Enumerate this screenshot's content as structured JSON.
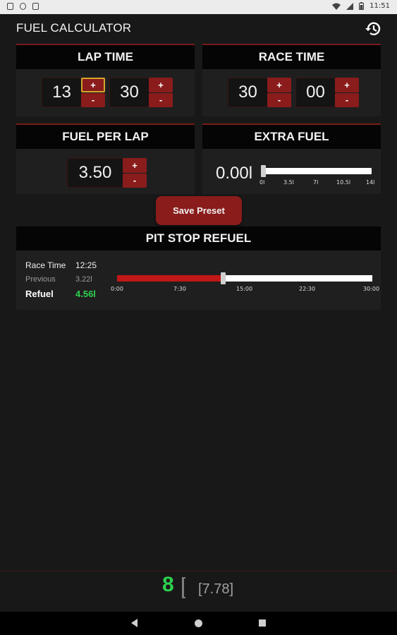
{
  "status_bar": {
    "time": "11:51"
  },
  "app": {
    "title": "FUEL CALCULATOR",
    "history_icon": "history-icon"
  },
  "lap_time": {
    "title": "LAP TIME",
    "minutes": "13",
    "seconds": "30",
    "plus": "+",
    "minus": "-"
  },
  "race_time": {
    "title": "RACE TIME",
    "minutes": "30",
    "seconds": "00",
    "plus": "+",
    "minus": "-"
  },
  "fuel_per_lap": {
    "title": "FUEL PER LAP",
    "value": "3.50",
    "plus": "+",
    "minus": "-"
  },
  "extra_fuel": {
    "title": "EXTRA FUEL",
    "value": "0.00l",
    "slider_value": 0,
    "slider_max": 14,
    "ticks": [
      "0l",
      "3.5l",
      "7l",
      "10.5l",
      "14l"
    ]
  },
  "save_preset": {
    "label": "Save Preset"
  },
  "pit_stop": {
    "title": "PIT STOP REFUEL",
    "race_time_label": "Race Time",
    "race_time_value": "12:25",
    "previous_label": "Previous",
    "previous_value": "3.22l",
    "refuel_label": "Refuel",
    "refuel_value": "4.56l",
    "slider_fraction": 0.414,
    "ticks": [
      "0:00",
      "7:30",
      "15:00",
      "22:30",
      "30:00"
    ]
  },
  "summary": {
    "laps": "8",
    "laps_exact": "[7.78]"
  },
  "colors": {
    "accent_red": "#8a1c1c",
    "refuel_green": "#2fcf4f",
    "track_red": "#c01717",
    "header_bg": "#050505"
  },
  "nav": {
    "back_icon": "back-icon",
    "home_icon": "home-icon",
    "recents_icon": "recents-icon"
  }
}
